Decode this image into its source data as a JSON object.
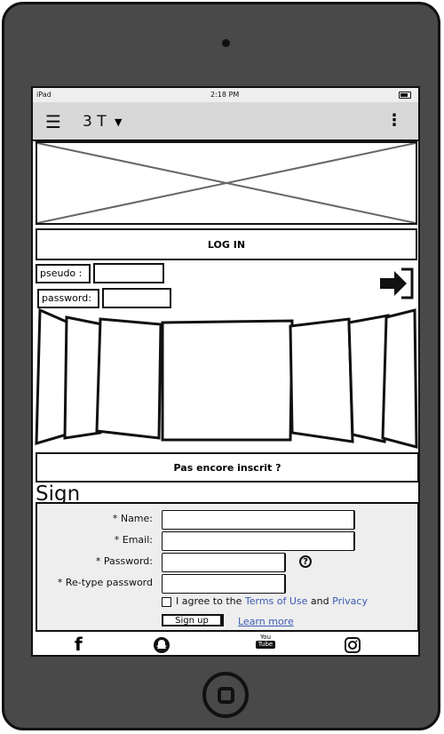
{
  "status": {
    "carrier": "iPad",
    "time": "2:18 PM"
  },
  "appbar": {
    "menu_icon": "hamburger-icon",
    "title": "3 T",
    "caret": "▼",
    "more_icon": "kebab-icon"
  },
  "login": {
    "title": "LOG IN",
    "pseudo_label": "pseudo :",
    "password_label": "password:",
    "pseudo_value": "",
    "password_value": "",
    "submit_icon": "login-arrow-icon"
  },
  "not_registered": "Pas encore inscrit ?",
  "signup_form": {
    "title": "Sign",
    "name_label": "* Name:",
    "email_label": "* Email:",
    "password_label": "* Password:",
    "retype_label": "* Re-type password",
    "name_value": "",
    "email_value": "",
    "password_value": "",
    "retype_value": "",
    "help_icon": "?",
    "agree_prefix": "I agree to the ",
    "terms_link": "Terms of Use",
    "agree_mid": " and ",
    "privacy_link": "Privacy",
    "submit_label": "Sign up",
    "learn_more": "Learn more"
  },
  "social": {
    "facebook": "f",
    "youtube_top": "You",
    "youtube_bottom": "Tube"
  },
  "colors": {
    "device": "#494949",
    "appbar": "#d8d8d8",
    "form_bg": "#eeeeee",
    "link": "#3b5bb5"
  }
}
